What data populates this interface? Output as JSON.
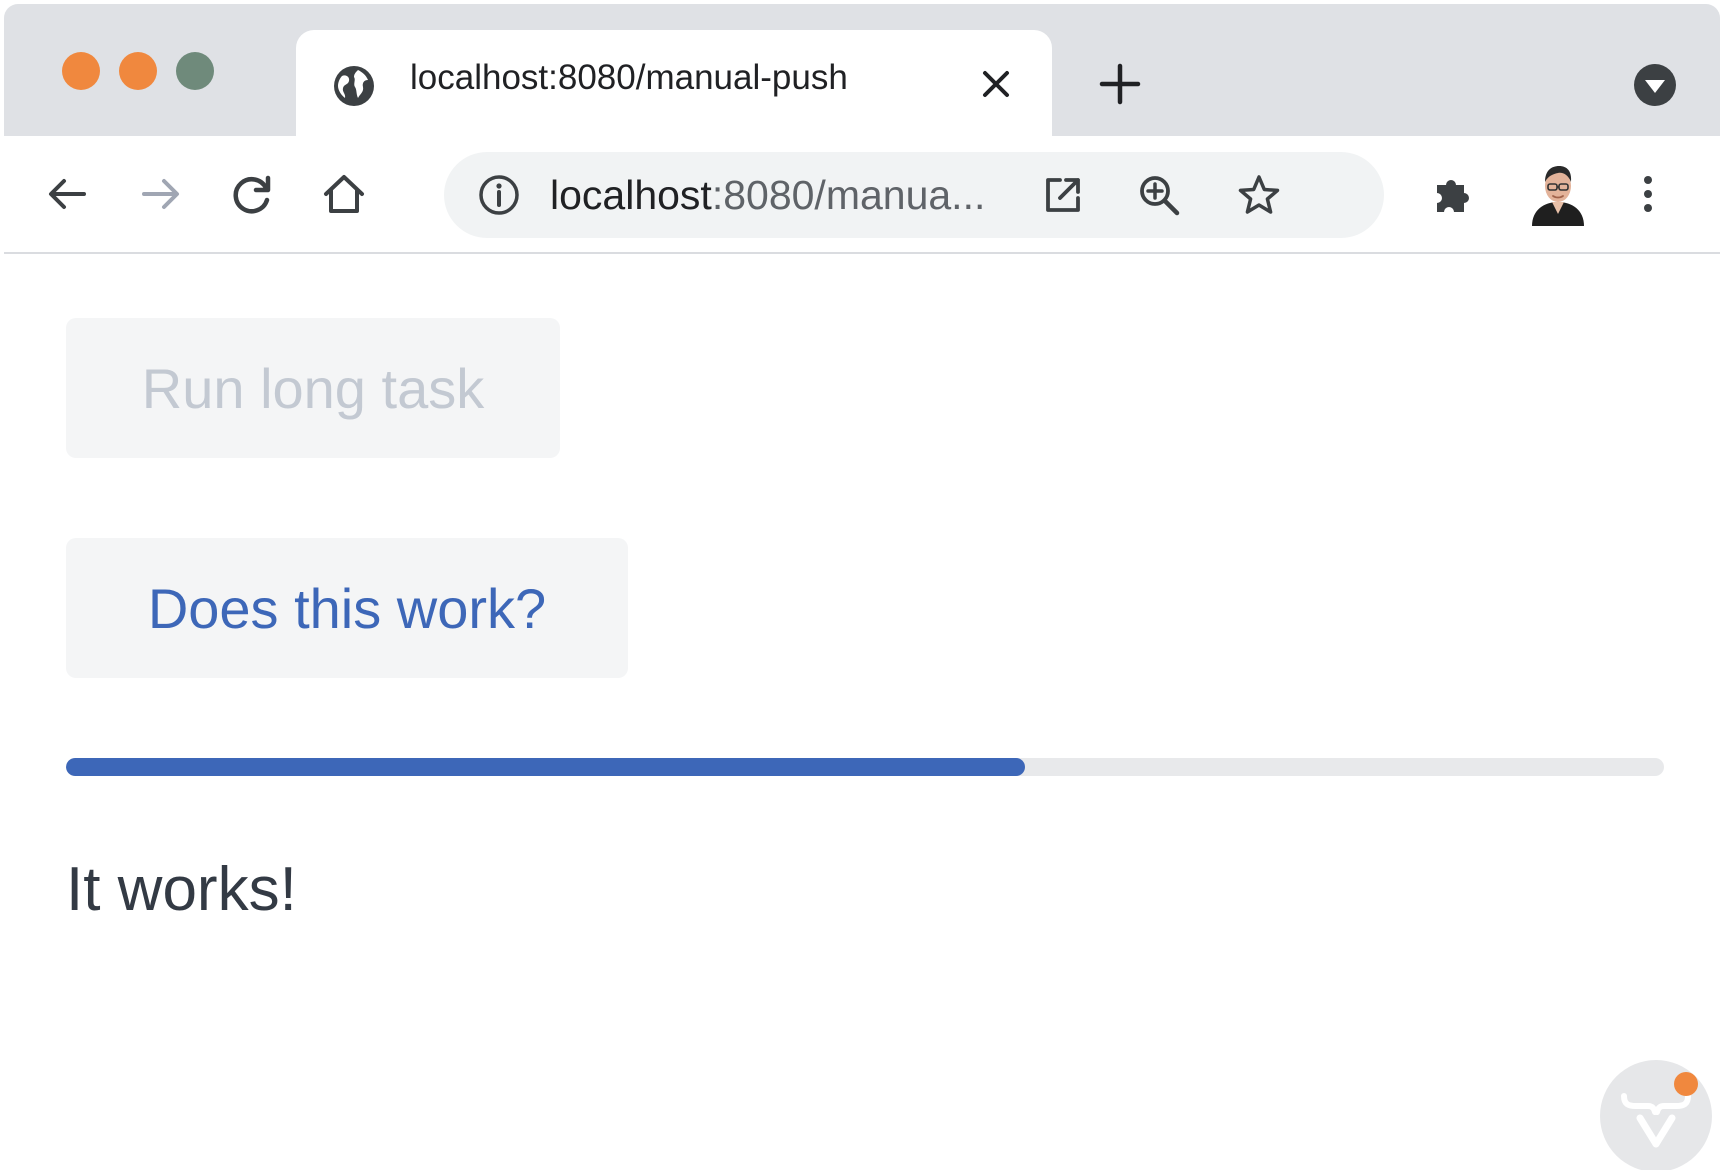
{
  "window": {
    "traffic_lights": {
      "close_color": "#f0883e",
      "minimize_color": "#f0883e",
      "zoom_color": "#6f8a7b"
    }
  },
  "tab": {
    "title": "localhost:8080/manual-push",
    "favicon": "globe-icon",
    "close_icon": "close-icon"
  },
  "tabstrip": {
    "new_tab_icon": "plus-icon",
    "tab_search_icon": "chevron-down-circle-icon"
  },
  "toolbar": {
    "back_icon": "back-arrow-icon",
    "forward_icon": "forward-arrow-icon",
    "reload_icon": "reload-icon",
    "home_icon": "home-icon",
    "extensions_icon": "puzzle-icon",
    "menu_icon": "kebab-menu-icon"
  },
  "omnibox": {
    "info_icon": "info-icon",
    "url_host": "localhost",
    "url_rest": ":8080/manua...",
    "open_icon": "open-in-new-icon",
    "zoom_icon": "zoom-in-icon",
    "bookmark_icon": "star-icon"
  },
  "page": {
    "run_button_label": "Run long task",
    "test_button_label": "Does this work?",
    "progress_fraction": 0.6,
    "message": "It works!",
    "accent_color": "#3d67b8"
  }
}
